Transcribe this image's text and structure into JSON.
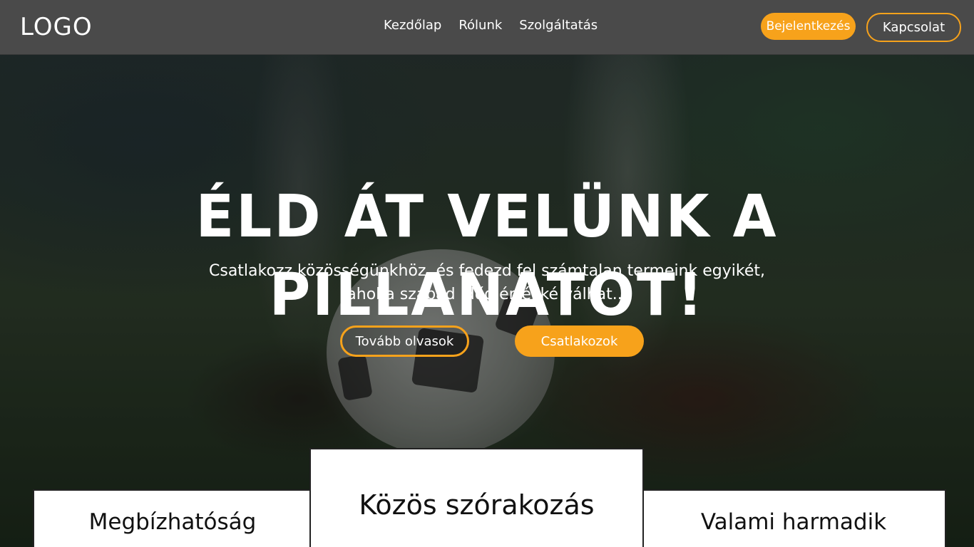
{
  "nav": {
    "logo": "LOGO",
    "links": [
      "Kezdőlap",
      "Rólunk",
      "Szolgáltatás"
    ],
    "login_label": "Bejelentkezés",
    "contact_label": "Kapcsolat"
  },
  "hero": {
    "title": "ÉLD ÁT VELÜNK A PILLANATOT!",
    "subtitle_line1": "Csatlakozz közösségünkhöz, és fedezd fel számtalan termeink egyikét,",
    "subtitle_line2": "ahol a szabad időd értékké válhat...",
    "read_more_label": "Tovább olvasok",
    "join_label": "Csatlakozok"
  },
  "cards": [
    {
      "title": "Megbízhatóság"
    },
    {
      "title": "Közös szórakozás"
    },
    {
      "title": "Valami harmadik"
    }
  ],
  "colors": {
    "accent": "#f7a21b",
    "navbar": "#4a4a4a"
  }
}
